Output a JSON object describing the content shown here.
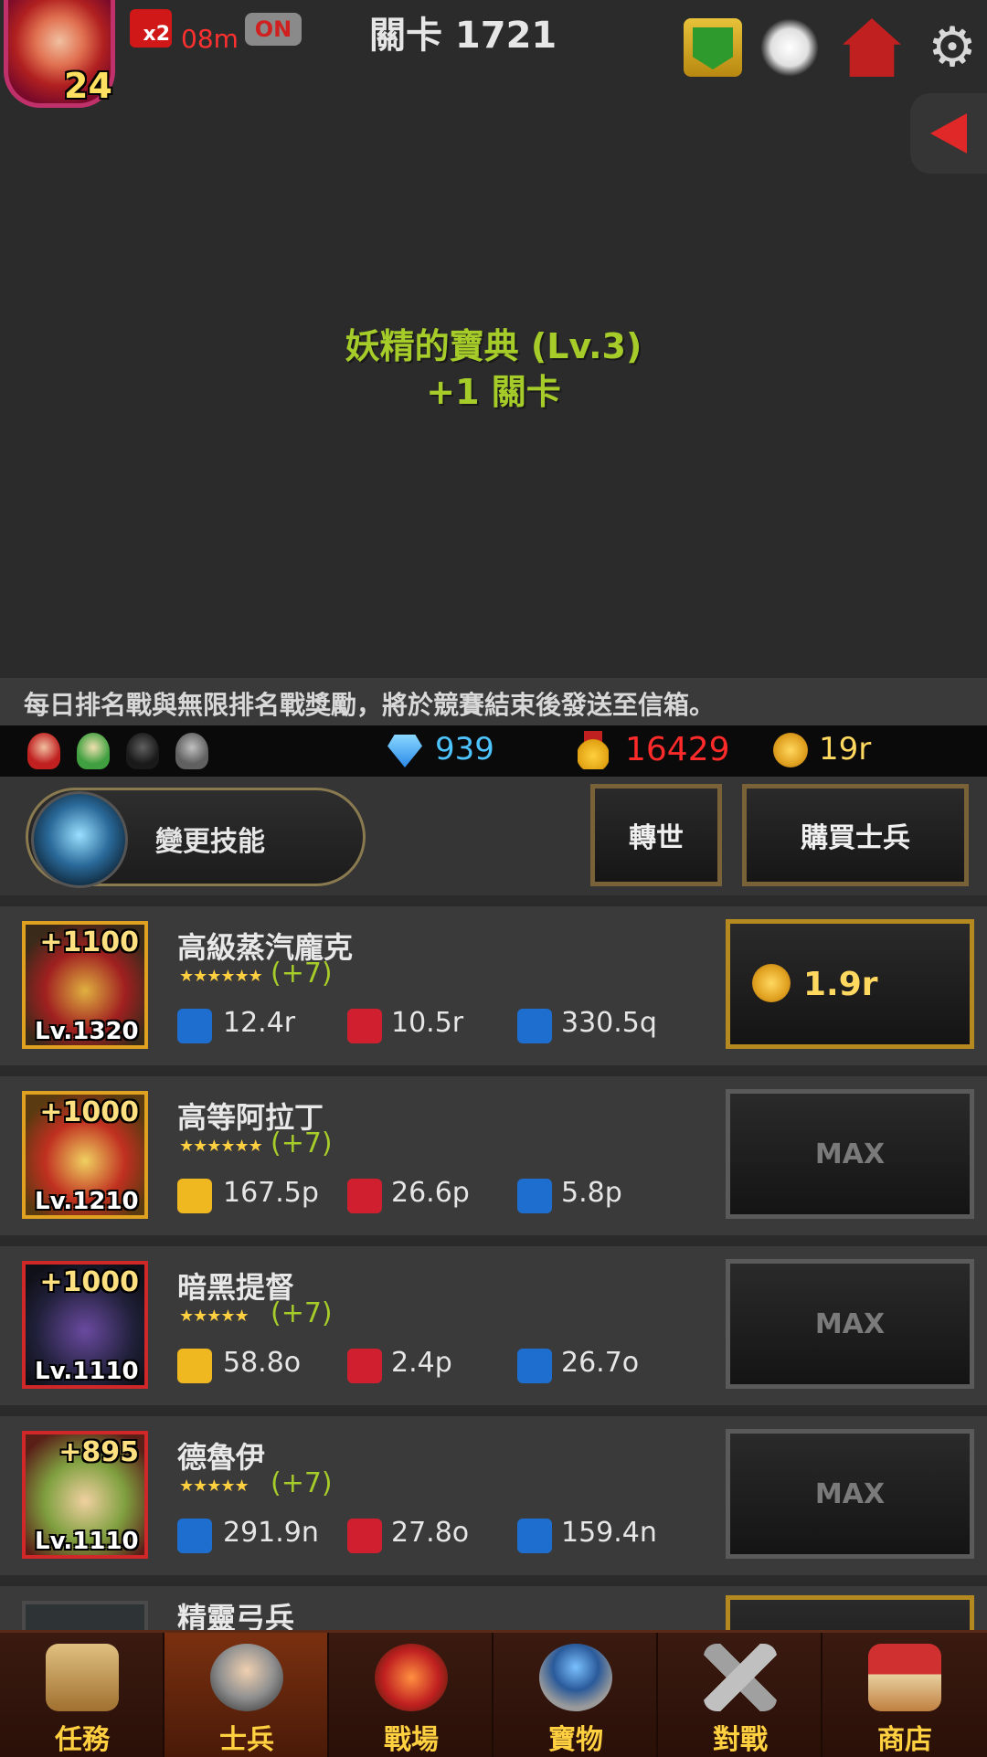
{
  "header": {
    "player_level": "24",
    "speed_label": "x2",
    "speed_timer": "08m",
    "auto_toggle": "ON",
    "stage_label": "關卡 1721"
  },
  "buff": {
    "line1": "妖精的寶典 (Lv.3)",
    "line2": "+1 關卡"
  },
  "notice": "每日排名戰與無限排名戰獎勵，將於競賽結束後發送至信箱。",
  "resources": {
    "gems": "939",
    "medals": "16429",
    "gold": "19r"
  },
  "actions": {
    "skill_label": "變更技能",
    "rebirth_label": "轉世",
    "buy_soldier_label": "購買士兵"
  },
  "soldiers": [
    {
      "name": "高級蒸汽龐克",
      "bonus": "+1100",
      "level": "Lv.1320",
      "stars": "★★★★★★",
      "upgrade": "(+7)",
      "stats": [
        "12.4r",
        "10.5r",
        "330.5q"
      ],
      "button": "1.9r"
    },
    {
      "name": "高等阿拉丁",
      "bonus": "+1000",
      "level": "Lv.1210",
      "stars": "★★★★★★",
      "upgrade": "(+7)",
      "stats": [
        "167.5p",
        "26.6p",
        "5.8p"
      ],
      "button": "MAX"
    },
    {
      "name": "暗黑提督",
      "bonus": "+1000",
      "level": "Lv.1110",
      "stars": "★★★★★",
      "upgrade": "(+7)",
      "stats": [
        "58.8o",
        "2.4p",
        "26.7o"
      ],
      "button": "MAX"
    },
    {
      "name": "德魯伊",
      "bonus": "+895",
      "level": "Lv.1110",
      "stars": "★★★★★",
      "upgrade": "(+7)",
      "stats": [
        "291.9n",
        "27.8o",
        "159.4n"
      ],
      "button": "MAX"
    },
    {
      "name": "精靈弓兵"
    }
  ],
  "nav": [
    "任務",
    "士兵",
    "戰場",
    "寶物",
    "對戰",
    "商店"
  ],
  "colors": {
    "accent_green": "#a6cc2a",
    "gold": "#ffd860",
    "gem_blue": "#4ec4ff",
    "medal_red": "#ff2a2a"
  }
}
